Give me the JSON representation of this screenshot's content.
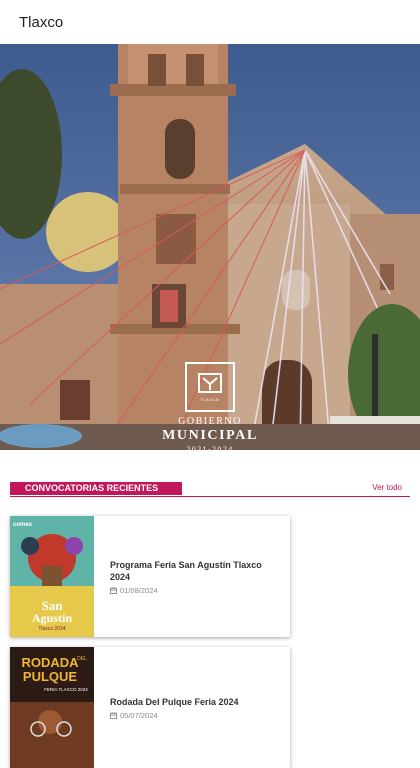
{
  "header": {
    "title": "Tlaxco"
  },
  "hero": {
    "logo_town": "TLAXCO",
    "line1": "GOBIERNO",
    "line2": "MUNICIPAL",
    "line3": "2021-2024"
  },
  "section": {
    "label": "CONVOCATORIAS RECIENTES",
    "see_all": "Ver todo"
  },
  "cards": [
    {
      "title": "Programa Feria San Agustín Tlaxco 2024",
      "date": "01/08/2024",
      "poster_brand": "comex",
      "poster_line1": "San",
      "poster_line2": "Agustín",
      "poster_line3": "Tlaxco 2024"
    },
    {
      "title": "Rodada Del Pulque Feria 2024",
      "date": "05/07/2024",
      "poster_line1": "RODADA",
      "poster_line2": "PULQUE",
      "poster_line3": "DEL",
      "poster_line4": "FERIA TLAXCO 2024"
    }
  ]
}
